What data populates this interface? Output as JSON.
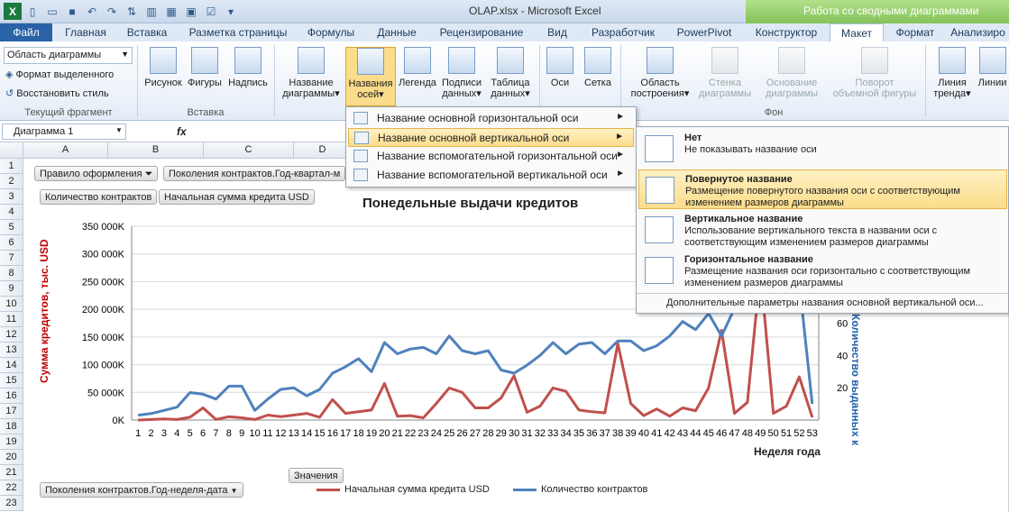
{
  "window": {
    "title": "OLAP.xlsx - Microsoft Excel",
    "context_tab_group": "Работа со сводными диаграммами"
  },
  "tabs": [
    "Файл",
    "Главная",
    "Вставка",
    "Разметка страницы",
    "Формулы",
    "Данные",
    "Рецензирование",
    "Вид",
    "Разработчик",
    "PowerPivot",
    "Конструктор",
    "Макет",
    "Формат",
    "Анализиро"
  ],
  "ribbon": {
    "current_selection": {
      "value": "Область диаграммы",
      "format_button": "Формат выделенного",
      "reset_button": "Восстановить стиль",
      "group": "Текущий фрагмент"
    },
    "insert": {
      "picture": "Рисунок",
      "shapes": "Фигуры",
      "textbox": "Надпись",
      "group": "Вставка"
    },
    "labels": {
      "chart_title": [
        "Название",
        "диаграммы"
      ],
      "axis_titles": [
        "Названия",
        "осей"
      ],
      "legend": [
        "Легенда",
        ""
      ],
      "data_labels": [
        "Подписи",
        "данных"
      ],
      "data_table": [
        "Таблица",
        "данных"
      ]
    },
    "axes": {
      "axes": "Оси",
      "gridlines": "Сетка"
    },
    "background": {
      "plot_area": [
        "Область",
        "построения"
      ],
      "wall": [
        "Стенка",
        "диаграммы"
      ],
      "floor": [
        "Основание",
        "диаграммы"
      ],
      "rotation": [
        "Поворот",
        "объемной фигуры"
      ],
      "group": "Фон"
    },
    "analysis": {
      "trendline": [
        "Линия",
        "тренда"
      ],
      "lines": [
        "Линии",
        ""
      ]
    }
  },
  "formula_bar": {
    "name_box": "Диаграмма 1",
    "fx": "fx"
  },
  "columns": [
    "A",
    "B",
    "C",
    "D"
  ],
  "rows": [
    "1",
    "2",
    "3",
    "4",
    "5",
    "6",
    "7",
    "8",
    "9",
    "10",
    "11",
    "12",
    "13",
    "14",
    "15",
    "16",
    "17",
    "18",
    "19",
    "20",
    "21",
    "22",
    "23"
  ],
  "pivot_buttons": {
    "rule": "Правило оформления",
    "generations_quarter": "Поколения контрактов.Год-квартал-м",
    "contracts_count": "Количество контрактов",
    "initial_sum": "Начальная сумма кредита USD",
    "values": "Значения",
    "generations_week": "Поколения контрактов.Год-неделя-дата"
  },
  "axis_menu": {
    "items": [
      "Название основной горизонтальной оси",
      "Название основной вертикальной оси",
      "Название вспомогательной горизонтальной оси",
      "Название вспомогательной вертикальной оси"
    ],
    "highlighted": 1
  },
  "vertical_submenu": {
    "items": [
      {
        "title": "Нет",
        "desc": "Не показывать название оси"
      },
      {
        "title": "Повернутое название",
        "desc": "Размещение повернутого названия оси с соответствующим изменением размеров диаграммы"
      },
      {
        "title": "Вертикальное название",
        "desc": "Использование вертикального текста в названии оси с соответствующим изменением размеров диаграммы"
      },
      {
        "title": "Горизонтальное название",
        "desc": "Размещение названия оси горизонтально с соответствующим изменением размеров диаграммы"
      }
    ],
    "highlighted": 1,
    "footer": "Дополнительные параметры названия основной вертикальной оси..."
  },
  "colors": {
    "red_series": "#c0504d",
    "blue_series": "#4f81bd",
    "highlight": "#fbdc8a",
    "file_tab": "#2a62a8"
  },
  "chart_data": {
    "type": "line",
    "title": "Понедельные выдачи кредитов",
    "xlabel": "Неделя года",
    "ylabel": "Сумма кредитов, тыс. USD",
    "y2label": "Количество выданных к",
    "x": [
      1,
      2,
      3,
      4,
      5,
      6,
      7,
      8,
      9,
      10,
      11,
      12,
      13,
      14,
      15,
      16,
      17,
      18,
      19,
      20,
      21,
      22,
      23,
      24,
      25,
      26,
      27,
      28,
      29,
      30,
      31,
      32,
      33,
      34,
      35,
      36,
      37,
      38,
      39,
      40,
      41,
      42,
      43,
      44,
      45,
      46,
      47,
      48,
      49,
      50,
      51,
      52,
      53
    ],
    "ylim": [
      0,
      350000
    ],
    "y_ticks": [
      "0K",
      "50 000K",
      "100 000K",
      "150 000K",
      "200 000K",
      "250 000K",
      "300 000K",
      "350 000K"
    ],
    "y2_ticks": [
      "20",
      "40",
      "60"
    ],
    "y2_ticks_values": [
      20,
      40,
      60
    ],
    "y2lim": [
      0,
      120
    ],
    "grid": true,
    "legend_position": "bottom",
    "series": [
      {
        "name": "Начальная сумма кредита USD",
        "axis": "primary",
        "color": "#c0504d",
        "values": [
          0,
          1000,
          2000,
          1000,
          5000,
          22000,
          1000,
          6000,
          4000,
          1000,
          9000,
          6000,
          9000,
          12000,
          5000,
          37000,
          12000,
          15000,
          18000,
          66000,
          7000,
          8000,
          4000,
          30000,
          58000,
          50000,
          22000,
          22000,
          40000,
          80000,
          14000,
          25000,
          58000,
          52000,
          18000,
          15000,
          13000,
          138000,
          30000,
          8000,
          20000,
          7000,
          22000,
          17000,
          58000,
          162000,
          12000,
          32000,
          270000,
          12000,
          25000,
          78000,
          5000
        ]
      },
      {
        "name": "Количество контрактов",
        "axis": "secondary",
        "color": "#4f81bd",
        "values": [
          3,
          4,
          6,
          8,
          17,
          16,
          13,
          21,
          21,
          6,
          13,
          19,
          20,
          15,
          19,
          29,
          33,
          38,
          30,
          48,
          41,
          44,
          45,
          41,
          52,
          43,
          41,
          43,
          31,
          29,
          34,
          40,
          48,
          41,
          47,
          48,
          41,
          49,
          49,
          43,
          46,
          52,
          61,
          56,
          66,
          52,
          69,
          96,
          125,
          110,
          100,
          85,
          10
        ]
      }
    ],
    "x_categories_count": 53
  }
}
